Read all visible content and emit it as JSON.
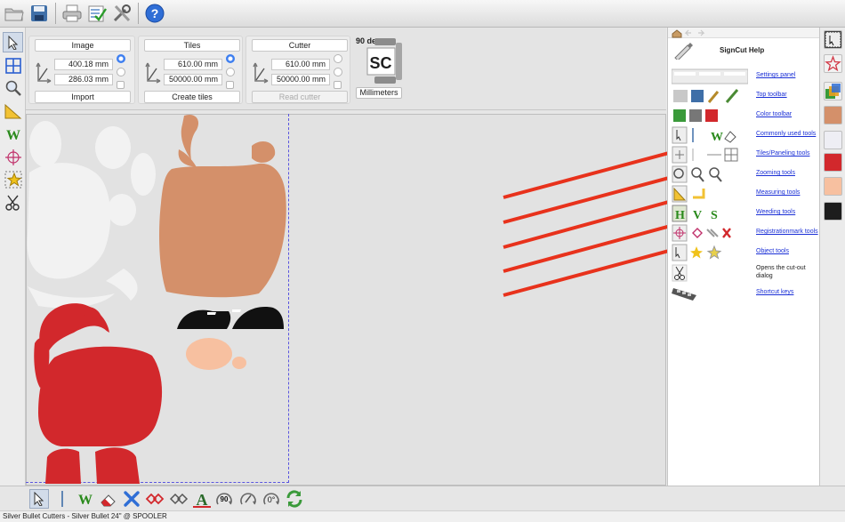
{
  "settings": {
    "image": {
      "title": "Image",
      "width": "400.18 mm",
      "height": "286.03 mm",
      "action": "Import"
    },
    "tiles": {
      "title": "Tiles",
      "width": "610.00 mm",
      "height": "50000.00 mm",
      "action": "Create tiles"
    },
    "cutter": {
      "title": "Cutter",
      "width": "610.00 mm",
      "height": "50000.00 mm",
      "action": "Read cutter"
    },
    "rotation": "90 deg",
    "units": "Millimeters",
    "logo_text": "SC"
  },
  "help": {
    "title": "SignCut Help",
    "items": [
      {
        "link": "Settings panel"
      },
      {
        "link": "Top toolbar"
      },
      {
        "link": "Color toolbar"
      },
      {
        "link": "Commonly used tools"
      },
      {
        "link": "Tiles/Paneling tools"
      },
      {
        "link": "Zooming tools"
      },
      {
        "link": "Measuring tools"
      },
      {
        "link": "Weeding tools"
      },
      {
        "link": "Registrationmark tools"
      },
      {
        "link": "Object tools"
      },
      {
        "text": "Opens the cut-out dialog"
      },
      {
        "link": "Shortcut keys"
      }
    ]
  },
  "bottom": {
    "rotate_90": "90",
    "rotate_0": "0°"
  },
  "colors": {
    "swatches": [
      "#d4906a",
      "#eeeef4",
      "#d2282c",
      "#f7c0a0",
      "#1d1d1d"
    ],
    "arrow": "#e8321c"
  },
  "status": "Silver Bullet Cutters - Silver Bullet 24\" @ SPOOLER"
}
